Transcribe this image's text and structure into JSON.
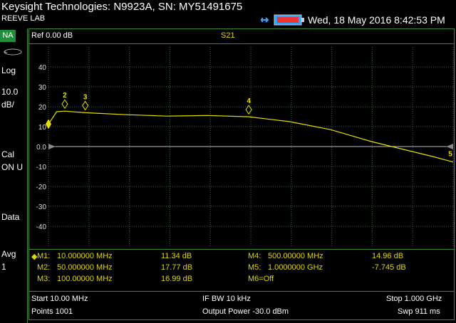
{
  "header": {
    "title": "Keysight Technologies: N9923A, SN: MY51491675",
    "lab": "REEVE LAB",
    "datetime": "Wed, 18 May 2016 8:42:53 PM"
  },
  "sidebar": {
    "mode": "NA",
    "format": "Log",
    "scale_value": "10.0",
    "scale_unit": "dB/",
    "cal": "Cal",
    "cal_state": "ON U",
    "data": "Data",
    "avg": "Avg",
    "avg_count": "1"
  },
  "plot": {
    "ref_level": "Ref 0.00 dB",
    "trace_name": "S21",
    "y_ticks": [
      "40",
      "30",
      "20",
      "10",
      "0.0",
      "-10",
      "-20",
      "-30",
      "-40"
    ],
    "marker_labels": [
      "2",
      "3",
      "4"
    ],
    "right_marker_label": "5"
  },
  "markers": [
    {
      "label": "M1:",
      "freq": "10.000000 MHz",
      "value": "11.34 dB"
    },
    {
      "label": "M2:",
      "freq": "50.000000 MHz",
      "value": "17.77 dB"
    },
    {
      "label": "M3:",
      "freq": "100.00000 MHz",
      "value": "16.99 dB"
    },
    {
      "label": "M4:",
      "freq": "500.00000 MHz",
      "value": "14.96 dB"
    },
    {
      "label": "M5:",
      "freq": "1.0000000 GHz",
      "value": "-7.745 dB"
    },
    {
      "label": "M6=Off",
      "freq": "",
      "value": ""
    }
  ],
  "footer": {
    "start": "Start 10.00 MHz",
    "ifbw": "IF BW 10 kHz",
    "stop": "Stop 1.000 GHz",
    "points": "Points 1001",
    "power": "Output Power -30.0 dBm",
    "sweep": "Swp 911 ms"
  },
  "colors": {
    "trace": "#e8e000",
    "grid": "#3a6a3a",
    "mode_badge": "#1e8f3a",
    "battery": "#2aa8ff"
  },
  "chart_data": {
    "type": "line",
    "title": "S21",
    "xlabel": "",
    "ylabel": "",
    "xlim": [
      10,
      1000
    ],
    "ylim": [
      -50,
      50
    ],
    "y_ref": 0,
    "series": [
      {
        "name": "S21",
        "x": [
          10,
          30,
          50,
          100,
          200,
          300,
          400,
          500,
          600,
          700,
          800,
          900,
          950,
          1000
        ],
        "y": [
          11.3,
          17.5,
          17.77,
          16.99,
          16.0,
          15.3,
          15.6,
          14.96,
          12.5,
          8.5,
          2.5,
          -2.5,
          -5.0,
          -7.745
        ]
      }
    ]
  }
}
